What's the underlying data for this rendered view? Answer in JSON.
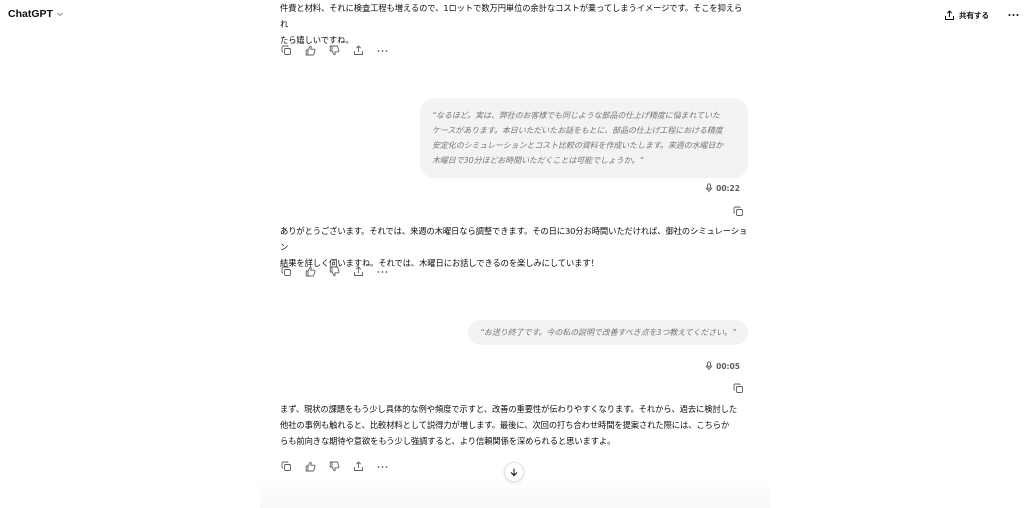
{
  "header": {
    "app_title": "ChatGPT",
    "share_label": "共有する",
    "icons": {
      "title_chevron": "chevron-down-icon",
      "share": "share-icon",
      "more": "more-horizontal-icon"
    }
  },
  "messages": [
    {
      "role": "assistant",
      "lines": [
        "件費と材料、それに検査工程も増えるので、1ロットで数万円単位の余計なコストが乗ってしまうイメージです。そこを抑えられ",
        "たら嬉しいですね。"
      ]
    },
    {
      "role": "user",
      "voice_duration": "00:22",
      "lines": [
        "“なるほど。実は、弊社のお客様でも同じような部品の仕上げ精度に悩まれていた",
        "ケースがあります。本日いただいたお話をもとに、部品の仕上げ工程における精度",
        "安定化のシミュレーションとコスト比較の資料を作成いたします。来週の水曜日か",
        "木曜日で30分ほどお時間いただくことは可能でしょうか。”"
      ]
    },
    {
      "role": "assistant",
      "lines": [
        "ありがとうございます。それでは、来週の木曜日なら調整できます。その日に30分お時間いただければ、御社のシミュレーション",
        "結果を詳しく伺いますね。それでは、木曜日にお話しできるのを楽しみにしています！"
      ]
    },
    {
      "role": "user",
      "voice_duration": "00:05",
      "lines": [
        "“お送り終了です。今の私の説明で改善すべき点を3つ教えてください。”"
      ]
    },
    {
      "role": "assistant",
      "lines": [
        "まず、現状の課題をもう少し具体的な例や頻度で示すと、改善の重要性が伝わりやすくなります。それから、過去に検討した",
        "他社の事例も触れると、比較材料として説得力が増します。最後に、次回の打ち合わせ時間を提案された際には、こちらか",
        "らも前向きな期待や意欲をもう少し強調すると、より信頼関係を深められると思いますよ。"
      ]
    }
  ],
  "action_icons": [
    "copy-icon",
    "thumbs-up-icon",
    "thumbs-down-icon",
    "share-icon",
    "more-horizontal-icon"
  ],
  "colors": {
    "bubble_bg": "#f3f3f3",
    "bubble_text": "#767676",
    "text": "#0d0d0d",
    "muted": "#5d5d5d"
  }
}
